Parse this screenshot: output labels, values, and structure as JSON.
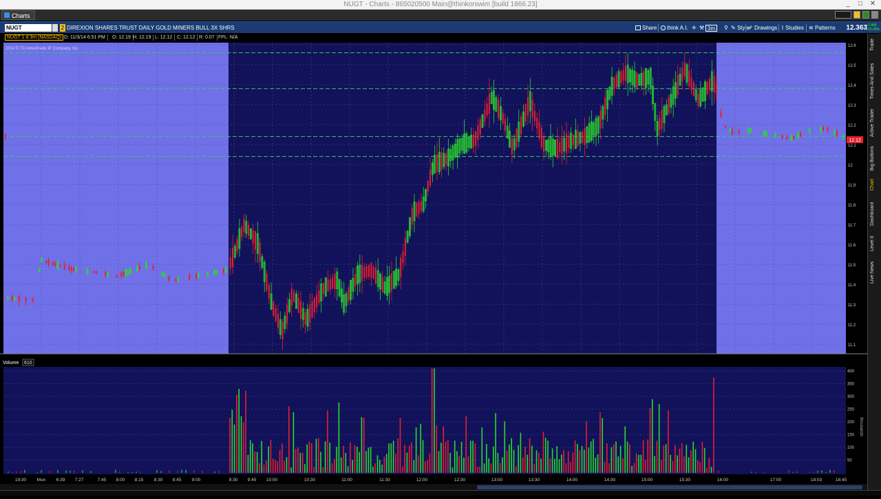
{
  "window": {
    "title": "NUGT - Charts - 865020500 Main@thinkorswim [build 1866.23]",
    "minimize": "_",
    "maximize": "□",
    "close": "✕"
  },
  "tab": {
    "label": "Charts"
  },
  "toolbar": {
    "symbol": "NUGT",
    "badge": "2",
    "description": "DIREXION SHARES TRUST DAILY GOLD MINERS BULL 3X SHRS",
    "share": "Share",
    "think": "think A.I.",
    "agg": "3m",
    "style": "Style",
    "drawings": "Drawings",
    "studies": "Studies",
    "patterns": "Patterns",
    "last": "12.363",
    "change_top": "+1.446",
    "change_bottom": "+13.25%"
  },
  "infobar": {
    "symtag": "NUGT 1 d 3m (NASDAQ)",
    "date": "D: 11/3/14 6:51 PM",
    "open": "O: 12.19",
    "high": "H: 12.19",
    "low": "L: 12.12",
    "close": "C: 12.12",
    "range": "R: 0.07",
    "fpl": "FPL: N/A",
    "copyright": "2014 © TD Ameritrade IP Company, Inc."
  },
  "volume": {
    "label": "Volume",
    "value": "610",
    "unit": "thousands"
  },
  "side_tabs": [
    "Trade",
    "Times And Sales",
    "Active Trader",
    "Big Buttons",
    "Chart",
    "Dashboard",
    "Level II",
    "Live News"
  ],
  "price_axis": [
    "12.6",
    "12.5",
    "12.4",
    "12.3",
    "12.2",
    "12.1",
    "12",
    "11.9",
    "11.8",
    "11.7",
    "11.6",
    "11.5",
    "11.4",
    "11.3",
    "11.2",
    "11.1"
  ],
  "volume_axis": [
    "400",
    "350",
    "300",
    "250",
    "200",
    "150",
    "100",
    "50"
  ],
  "time_labels": [
    "19:30",
    "Mon",
    "6:39",
    "7:27",
    "7:45",
    "8:00",
    "8:15",
    "8:30",
    "8:45",
    "9:00",
    "9:30",
    "9:45",
    "10:00",
    "10:30",
    "11:00",
    "11:30",
    "12:00",
    "12:30",
    "13:00",
    "13:30",
    "14:00",
    "14:30",
    "15:00",
    "15:30",
    "16:00",
    "17:00",
    "18:03",
    "18:45"
  ],
  "current_price_tag": "12.12",
  "colors": {
    "regular_session": "#12125a",
    "extended_session": "#7070e8",
    "up": "#2bdc2b",
    "down": "#e81f2f",
    "level_line": "#33cc66",
    "grid": "#4848a8"
  }
}
